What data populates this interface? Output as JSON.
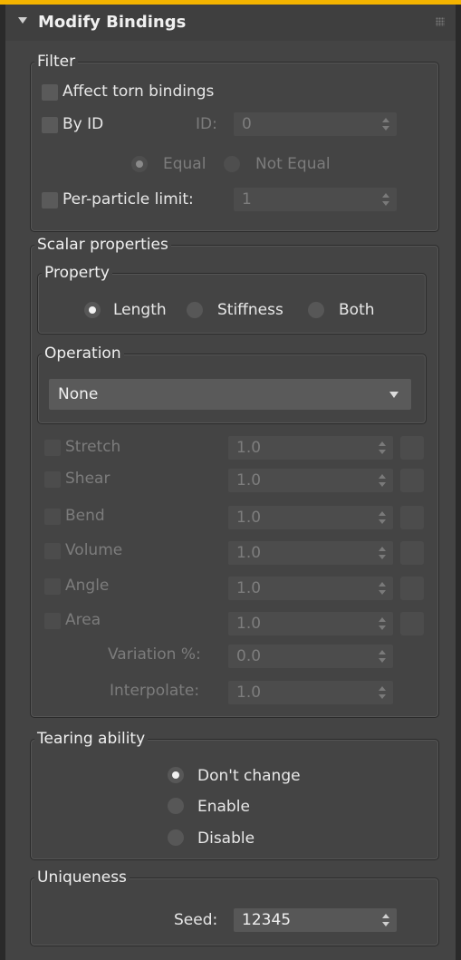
{
  "rollout": {
    "title": "Modify Bindings"
  },
  "filter": {
    "title": "Filter",
    "affect_torn": "Affect torn bindings",
    "by_id": "By ID",
    "id_label": "ID:",
    "id_value": "0",
    "equal": "Equal",
    "not_equal": "Not Equal",
    "per_particle_label": "Per-particle limit:",
    "per_particle_value": "1"
  },
  "scalar": {
    "title": "Scalar properties",
    "property": {
      "title": "Property",
      "length": "Length",
      "stiffness": "Stiffness",
      "both": "Both",
      "selected": "Length"
    },
    "operation": {
      "title": "Operation",
      "value": "None"
    },
    "rows": [
      {
        "label": "Stretch",
        "value": "1.0"
      },
      {
        "label": "Shear",
        "value": "1.0"
      },
      {
        "label": "Bend",
        "value": "1.0"
      },
      {
        "label": "Volume",
        "value": "1.0"
      },
      {
        "label": "Angle",
        "value": "1.0"
      },
      {
        "label": "Area",
        "value": "1.0"
      }
    ],
    "variation_label": "Variation %:",
    "variation_value": "0.0",
    "interpolate_label": "Interpolate:",
    "interpolate_value": "1.0"
  },
  "tearing": {
    "title": "Tearing ability",
    "dont_change": "Don't change",
    "enable": "Enable",
    "disable": "Disable",
    "selected": "Don't change"
  },
  "uniqueness": {
    "title": "Uniqueness",
    "seed_label": "Seed:",
    "seed_value": "12345"
  },
  "colors": {
    "accent_bar": "#f4b400",
    "panel_bg": "#444444",
    "field_bg": "#575757"
  }
}
